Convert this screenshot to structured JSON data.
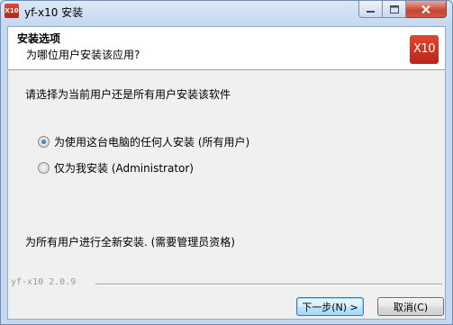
{
  "window": {
    "title": "yf-x10 安装",
    "icon_text": "X10",
    "controls": {
      "minimize": "─",
      "maximize": "☐",
      "close": "✕"
    }
  },
  "header": {
    "title": "安装选项",
    "subtitle": "为哪位用户安装该应用?",
    "logo_text": "X10"
  },
  "body": {
    "prompt": "请选择为当前用户还是所有用户安装该软件",
    "options": [
      {
        "label": "为使用这台电脑的任何人安装 (所有用户)",
        "checked": true
      },
      {
        "label": "仅为我安装 (Administrator)",
        "checked": false
      }
    ],
    "note": "为所有用户进行全新安装. (需要管理员资格)"
  },
  "footer": {
    "version": "yf-x10 2.0.9",
    "next_label": "下一步(N) >",
    "cancel_label": "取消(C)"
  },
  "colors": {
    "accent": "#c8311f",
    "title_bg": "#cfe0f3",
    "client_bg": "#f0f0f0"
  }
}
